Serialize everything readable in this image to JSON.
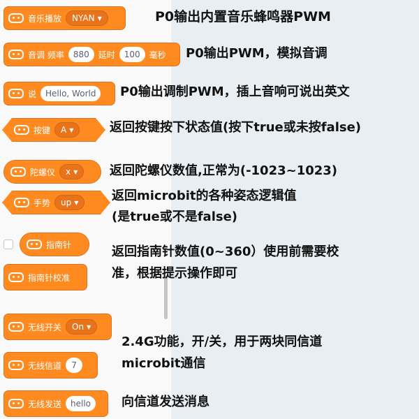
{
  "blocks": {
    "music": {
      "label": "音乐播放",
      "dropdown": "NYAN"
    },
    "tone": {
      "label": "音调 频率",
      "freq": "880",
      "delay_label": "延时",
      "delay": "100",
      "unit": "毫秒"
    },
    "speak": {
      "label": "说",
      "text": "Hello, World"
    },
    "button": {
      "label": "按键",
      "dropdown": "A"
    },
    "gyro": {
      "label": "陀螺仪",
      "dropdown": "x"
    },
    "gesture": {
      "label": "手势",
      "dropdown": "up"
    },
    "compass": {
      "label": "指南针"
    },
    "compass_calibrate": {
      "label": "指南针校准"
    },
    "radio_switch": {
      "label": "无线开关",
      "dropdown": "On"
    },
    "radio_channel": {
      "label": "无线信道",
      "value": "7"
    },
    "radio_send": {
      "label": "无线发送",
      "value": "hello"
    }
  },
  "notes": {
    "music": "P0输出内置音乐蜂鸣器PWM",
    "tone": "P0输出PWM，模拟音调",
    "speak": "P0输出调制PWM，插上音响可说出英文",
    "button": "返回按键按下状态值(按下true或未按false)",
    "gyro": "返回陀螺仪数值,正常为(-1023~1023)",
    "gesture_line1": "返回microbit的各种姿态逻辑值",
    "gesture_line2": "(是true或不是false)",
    "compass_line1": "返回指南针数值(0~360）使用前需要校",
    "compass_line2": "准，根据提示操作即可",
    "radio_line1": "2.4G功能，开/关，用于两块同信道",
    "radio_line2": "microbit通信",
    "radio_send": "向信道发送消息"
  },
  "colors": {
    "block": "#ff8a1f",
    "block_dark": "#e9731a",
    "panel": "#e9eef2"
  }
}
